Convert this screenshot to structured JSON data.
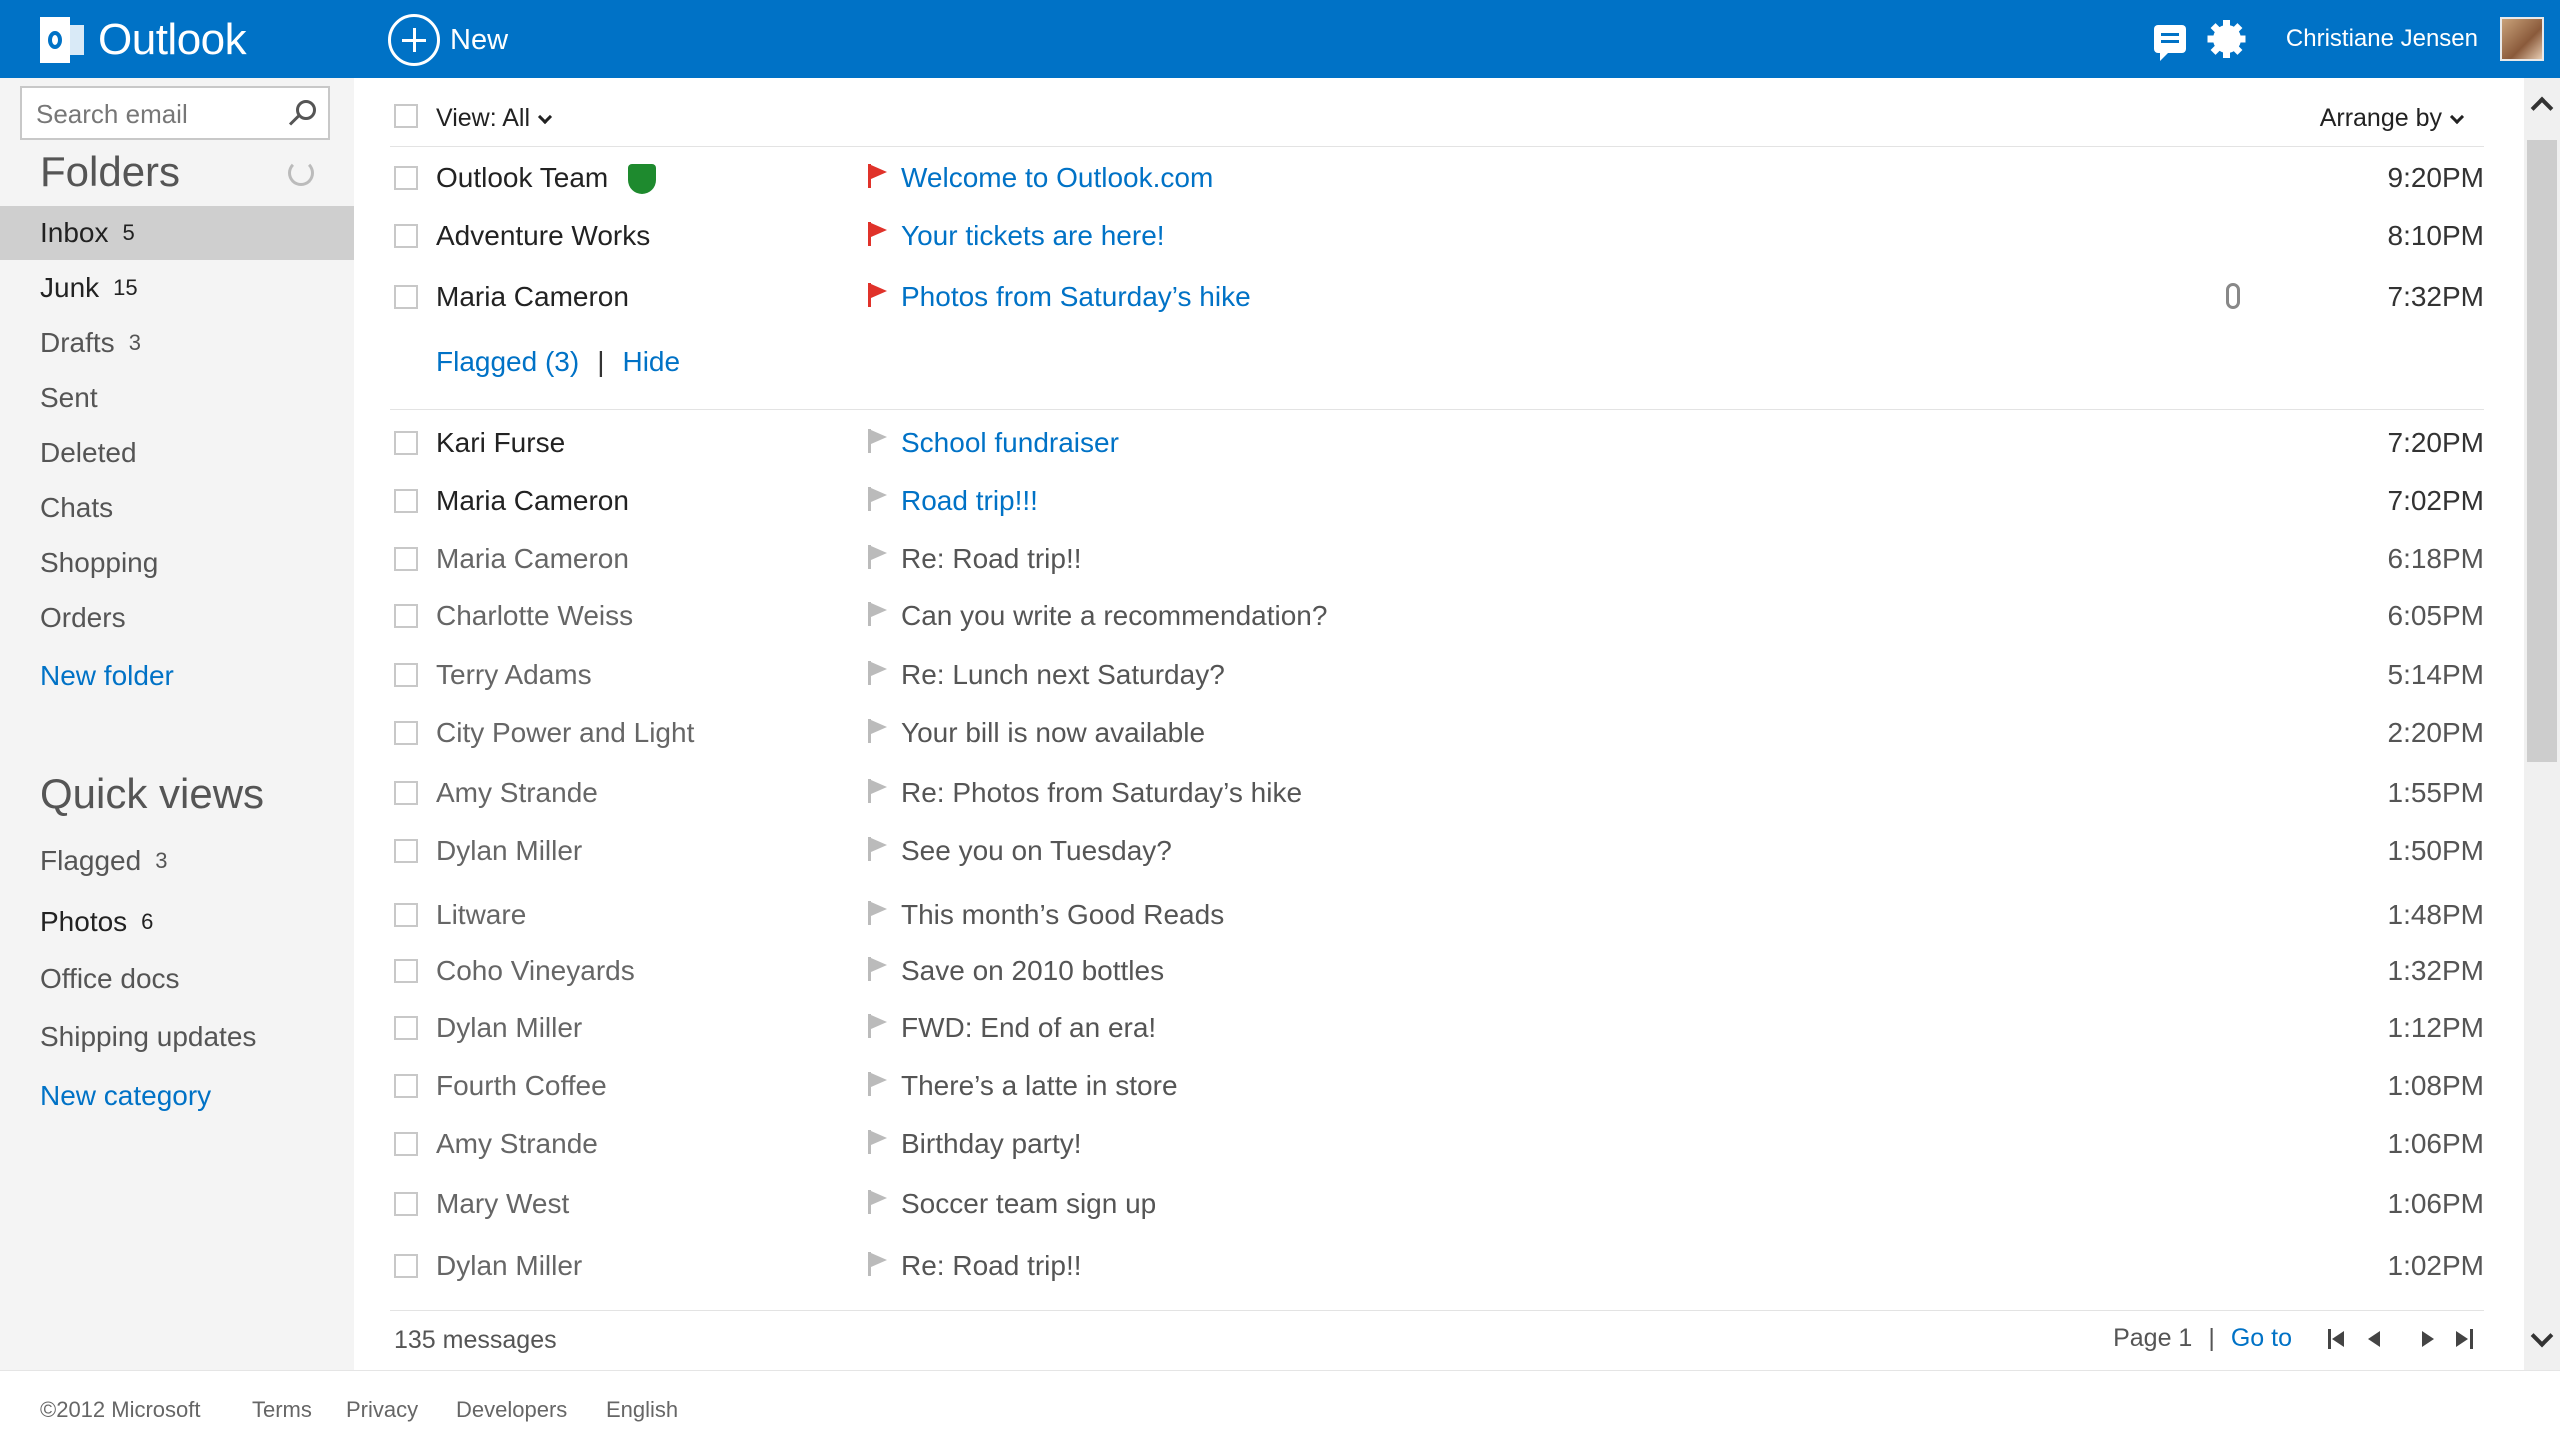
{
  "app": {
    "brand": "Outlook",
    "new_label": "New",
    "user_name": "Christiane Jensen"
  },
  "colors": {
    "accent": "#0072c6",
    "flag_active": "#e0322a",
    "safe_sender": "#1e8a2e"
  },
  "search": {
    "placeholder": "Search email",
    "value": ""
  },
  "folders": {
    "title": "Folders",
    "items": [
      {
        "label": "Inbox",
        "count": "5"
      },
      {
        "label": "Junk",
        "count": "15"
      },
      {
        "label": "Drafts",
        "count": "3"
      },
      {
        "label": "Sent",
        "count": ""
      },
      {
        "label": "Deleted",
        "count": ""
      },
      {
        "label": "Chats",
        "count": ""
      },
      {
        "label": "Shopping",
        "count": ""
      },
      {
        "label": "Orders",
        "count": ""
      }
    ],
    "new_folder": "New folder"
  },
  "quick_views": {
    "title": "Quick views",
    "items": [
      {
        "label": "Flagged",
        "count": "3"
      },
      {
        "label": "Photos",
        "count": "6"
      },
      {
        "label": "Office docs",
        "count": ""
      },
      {
        "label": "Shipping updates",
        "count": ""
      }
    ],
    "new_category": "New category"
  },
  "list": {
    "view_label": "View: All",
    "arrange_label": "Arrange by",
    "flagged_link": "Flagged (3)",
    "flagged_sep": "|",
    "hide_link": "Hide",
    "flagged_messages": [
      {
        "sender": "Outlook Team",
        "subject": "Welcome to Outlook.com",
        "time": "9:20PM"
      },
      {
        "sender": "Adventure Works",
        "subject": "Your tickets are here!",
        "time": "8:10PM"
      },
      {
        "sender": "Maria Cameron",
        "subject": "Photos from Saturday’s hike",
        "time": "7:32PM"
      }
    ],
    "messages": [
      {
        "sender": "Kari Furse",
        "subject": "School fundraiser",
        "time": "7:20PM"
      },
      {
        "sender": "Maria Cameron",
        "subject": "Road trip!!!",
        "time": "7:02PM"
      },
      {
        "sender": "Maria Cameron",
        "subject": "Re: Road trip!!",
        "time": "6:18PM"
      },
      {
        "sender": "Charlotte Weiss",
        "subject": "Can you write a recommendation?",
        "time": "6:05PM"
      },
      {
        "sender": "Terry Adams",
        "subject": "Re: Lunch next Saturday?",
        "time": "5:14PM"
      },
      {
        "sender": "City Power and Light",
        "subject": "Your bill is now available",
        "time": "2:20PM"
      },
      {
        "sender": "Amy Strande",
        "subject": "Re: Photos from Saturday’s hike",
        "time": "1:55PM"
      },
      {
        "sender": "Dylan Miller",
        "subject": "See you on Tuesday?",
        "time": "1:50PM"
      },
      {
        "sender": "Litware",
        "subject": "This month’s Good Reads",
        "time": "1:48PM"
      },
      {
        "sender": "Coho Vineyards",
        "subject": "Save on 2010 bottles",
        "time": "1:32PM"
      },
      {
        "sender": "Dylan Miller",
        "subject": "FWD: End of an era!",
        "time": "1:12PM"
      },
      {
        "sender": "Fourth Coffee",
        "subject": "There’s a latte in store",
        "time": "1:08PM"
      },
      {
        "sender": "Amy Strande",
        "subject": "Birthday party!",
        "time": "1:06PM"
      },
      {
        "sender": "Mary West",
        "subject": "Soccer team sign up",
        "time": "1:06PM"
      },
      {
        "sender": "Dylan Miller",
        "subject": "Re: Road trip!!",
        "time": "1:02PM"
      }
    ],
    "message_count": "135 messages",
    "page_label": "Page 1",
    "page_sep": "|",
    "goto_label": "Go to"
  },
  "footer": {
    "copyright": "©2012 Microsoft",
    "terms": "Terms",
    "privacy": "Privacy",
    "developers": "Developers",
    "language": "English"
  }
}
